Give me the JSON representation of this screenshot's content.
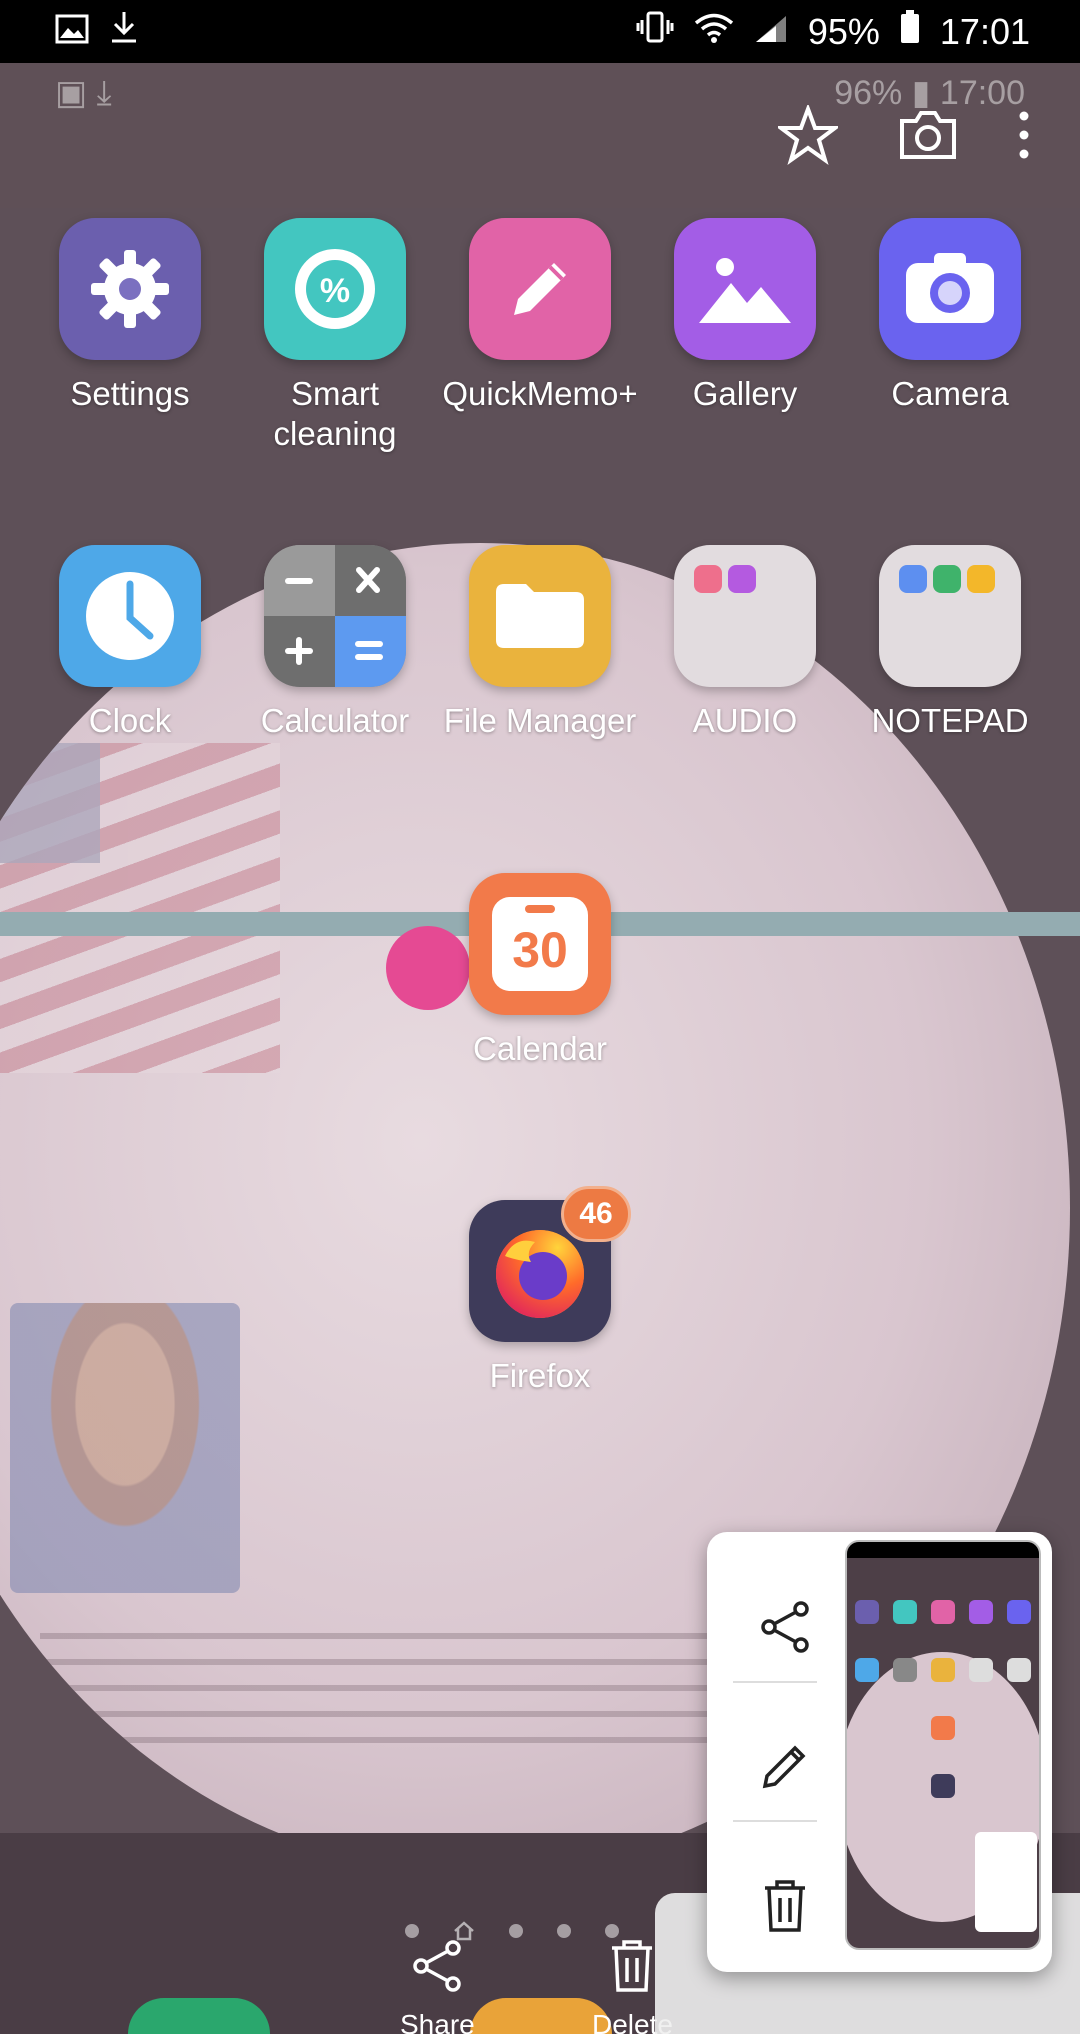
{
  "status": {
    "battery": "95%",
    "time": "17:01"
  },
  "old_status": {
    "battery": "96%",
    "time": "17:00"
  },
  "apps": [
    {
      "label": "Settings",
      "icon": "gear-icon",
      "color": "#6b5fae"
    },
    {
      "label": "Smart cleaning",
      "icon": "percent-icon",
      "color": "#43c6c0"
    },
    {
      "label": "QuickMemo+",
      "icon": "pencil-icon",
      "color": "#e163a7"
    },
    {
      "label": "Gallery",
      "icon": "gallery-icon",
      "color": "#a35de6"
    },
    {
      "label": "Camera",
      "icon": "camera-icon",
      "color": "#6a63ef"
    },
    {
      "label": "Clock",
      "icon": "clock-icon",
      "color": "#4ea8e8"
    },
    {
      "label": "Calculator",
      "icon": "calculator-icon",
      "color": "#888888"
    },
    {
      "label": "File Manager",
      "icon": "folder-icon",
      "color": "#eab33d"
    },
    {
      "label": "AUDIO",
      "icon": "folder-icon",
      "color": "#dddddd"
    },
    {
      "label": "NOTEPAD",
      "icon": "folder-icon",
      "color": "#dddddd"
    },
    {
      "label": "Calendar",
      "icon": "calendar-icon",
      "color": "#f27a4a",
      "date": "30"
    },
    {
      "label": "Firefox",
      "icon": "firefox-icon",
      "color": "#3e3b5a",
      "badge": "46"
    }
  ],
  "dock": {
    "share_label": "Share",
    "delete_label": "Delete"
  },
  "popup": {
    "share": "share-icon",
    "edit": "edit-icon",
    "delete": "trash-icon"
  }
}
